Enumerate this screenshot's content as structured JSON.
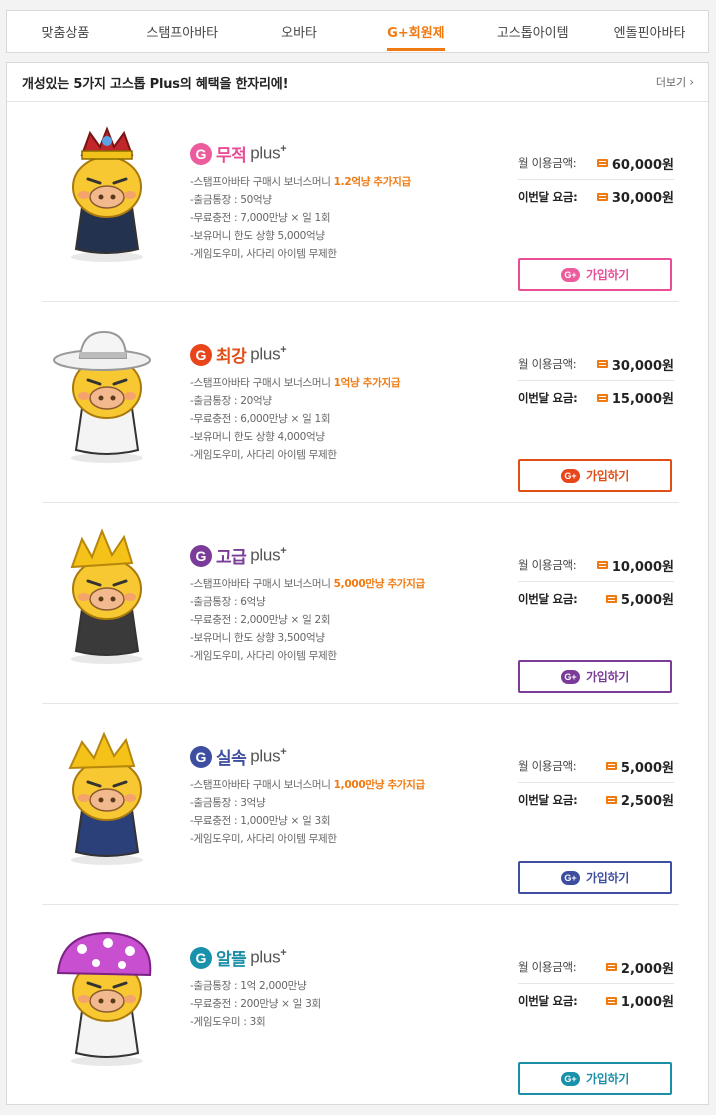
{
  "tabs": [
    {
      "label": "맞춤상품"
    },
    {
      "label": "스탬프아바타"
    },
    {
      "label": "오바타"
    },
    {
      "label": "G+회원제"
    },
    {
      "label": "고스톱아이템"
    },
    {
      "label": "엔돌핀아바타"
    }
  ],
  "active_tab": "G+회원제",
  "panel": {
    "title": "개성있는 5가지 고스톱 Plus의 혜택을 한자리에!",
    "more_label": "더보기"
  },
  "plans": [
    {
      "name": "무적",
      "plus": "plus",
      "color": "#e94d96",
      "g_color": "#ec5b9c",
      "features": [
        {
          "text": "-스탬프아바타 구매시 보너스머니 ",
          "highlight": "1.2억냥 추가지급"
        },
        {
          "text": "-출금통장 : 50억냥"
        },
        {
          "text": "-무료충전 : 7,000만냥 × 일 1회"
        },
        {
          "text": "-보유머니 한도 상향 5,000억냥"
        },
        {
          "text": "-게임도우미, 사다리 아이템 무제한"
        }
      ],
      "monthly_label": "월 이용금액:",
      "monthly_price": "60,000원",
      "this_month_label": "이번달 요금:",
      "this_month_price": "30,000원",
      "join_label": "가입하기",
      "badge": "G+"
    },
    {
      "name": "최강",
      "plus": "plus",
      "color": "#e04f17",
      "g_color": "#e8451b",
      "features": [
        {
          "text": "-스탬프아바타 구매시 보너스머니 ",
          "highlight": "1억냥 추가지급"
        },
        {
          "text": "-출금통장 : 20억냥"
        },
        {
          "text": "-무료충전 : 6,000만냥 × 일 1회"
        },
        {
          "text": "-보유머니 한도 상향 4,000억냥"
        },
        {
          "text": "-게임도우미, 사다리 아이템 무제한"
        }
      ],
      "monthly_label": "월 이용금액:",
      "monthly_price": "30,000원",
      "this_month_label": "이번달 요금:",
      "this_month_price": "15,000원",
      "join_label": "가입하기",
      "badge": "G+"
    },
    {
      "name": "고급",
      "plus": "plus",
      "color": "#7a3c96",
      "g_color": "#7b3b98",
      "features": [
        {
          "text": "-스탬프아바타 구매시 보너스머니 ",
          "highlight": "5,000만냥 추가지급"
        },
        {
          "text": "-출금통장 : 6억냥"
        },
        {
          "text": "-무료충전 : 2,000만냥 × 일 2회"
        },
        {
          "text": "-보유머니 한도 상향 3,500억냥"
        },
        {
          "text": "-게임도우미, 사다리 아이템 무제한"
        }
      ],
      "monthly_label": "월 이용금액:",
      "monthly_price": "10,000원",
      "this_month_label": "이번달 요금:",
      "this_month_price": "5,000원",
      "join_label": "가입하기",
      "badge": "G+"
    },
    {
      "name": "실속",
      "plus": "plus",
      "color": "#3e4fa0",
      "g_color": "#3d4ea1",
      "features": [
        {
          "text": "-스탬프아바타 구매시 보너스머니 ",
          "highlight": "1,000만냥 추가지급"
        },
        {
          "text": "-출금통장 : 3억냥"
        },
        {
          "text": "-무료충전 : 1,000만냥 × 일 3회"
        },
        {
          "text": "-게임도우미, 사다리 아이템 무제한"
        }
      ],
      "monthly_label": "월 이용금액:",
      "monthly_price": "5,000원",
      "this_month_label": "이번달 요금:",
      "this_month_price": "2,500원",
      "join_label": "가입하기",
      "badge": "G+"
    },
    {
      "name": "알뜰",
      "plus": "plus",
      "color": "#1b8fa8",
      "g_color": "#1891ab",
      "features": [
        {
          "text": "-출금통장 : 1억 2,000만냥"
        },
        {
          "text": "-무료충전 : 200만냥 × 일 3회"
        },
        {
          "text": "-게임도우미 : 3회"
        }
      ],
      "monthly_label": "월 이용금액:",
      "monthly_price": "2,000원",
      "this_month_label": "이번달 요금:",
      "this_month_price": "1,000원",
      "join_label": "가입하기",
      "badge": "G+"
    }
  ]
}
